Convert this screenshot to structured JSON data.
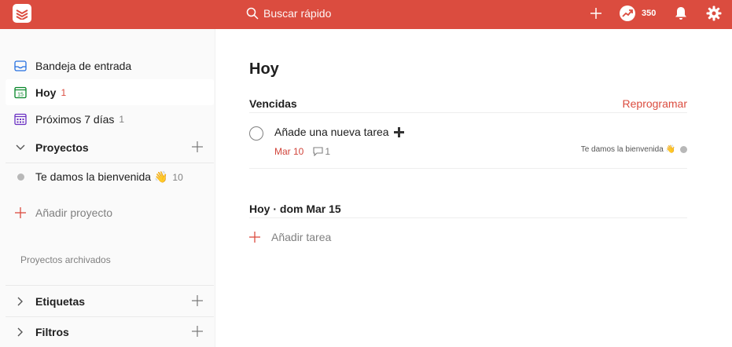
{
  "topbar": {
    "search_placeholder": "Buscar rápido",
    "karma": "350"
  },
  "sidebar": {
    "inbox": "Bandeja de entrada",
    "today": {
      "label": "Hoy",
      "count": "1"
    },
    "next7": {
      "label": "Próximos 7 días",
      "count": "1"
    },
    "projects_label": "Proyectos",
    "project_welcome": {
      "label": "Te damos la bienvenida 👋",
      "count": "10"
    },
    "add_project": "Añadir proyecto",
    "archived": "Proyectos archivados",
    "labels": "Etiquetas",
    "filters": "Filtros"
  },
  "main": {
    "title": "Hoy",
    "overdue_heading": "Vencidas",
    "reschedule": "Reprogramar",
    "task": {
      "text": "Añade una nueva tarea",
      "due": "Mar 10",
      "comments": "1",
      "project": "Te damos la bienvenida 👋"
    },
    "today_heading": "Hoy · dom Mar 15",
    "add_task": "Añadir tarea"
  },
  "colors": {
    "brand": "#db4c3f",
    "overdue": "#d1453b",
    "muted": "#808080"
  }
}
